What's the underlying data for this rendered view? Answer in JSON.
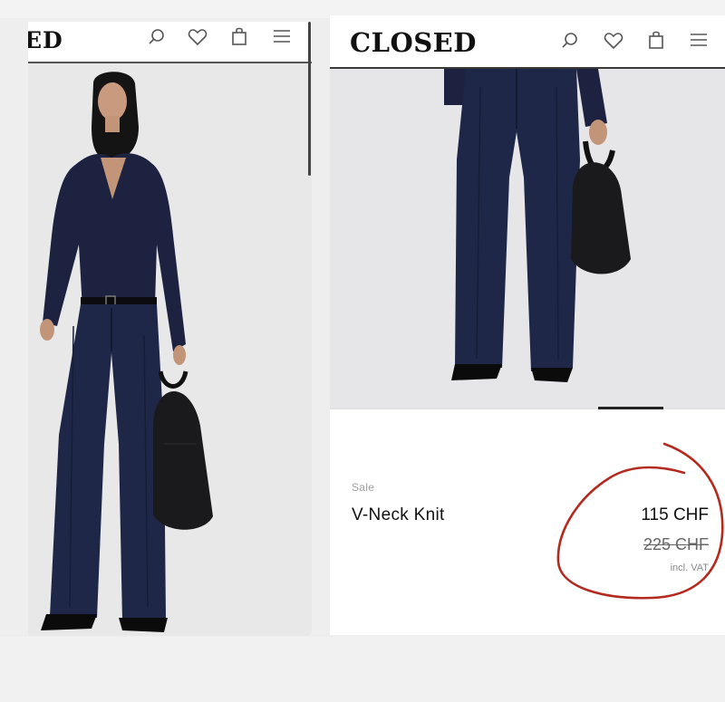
{
  "left_screen": {
    "logo_text": "ED",
    "icons": [
      "search-icon",
      "heart-icon",
      "bag-icon",
      "menu-icon"
    ]
  },
  "right_screen": {
    "logo_text": "CLOSED",
    "icons": [
      "search-icon",
      "heart-icon",
      "bag-icon",
      "menu-icon"
    ],
    "product": {
      "badge": "Sale",
      "name": "V-Neck Knit",
      "price_current": "115 CHF",
      "price_original": "225 CHF",
      "vat_note": "incl. VAT"
    }
  },
  "colors": {
    "garment_navy": "#1c2240",
    "annotation_red": "#b32a1e"
  }
}
